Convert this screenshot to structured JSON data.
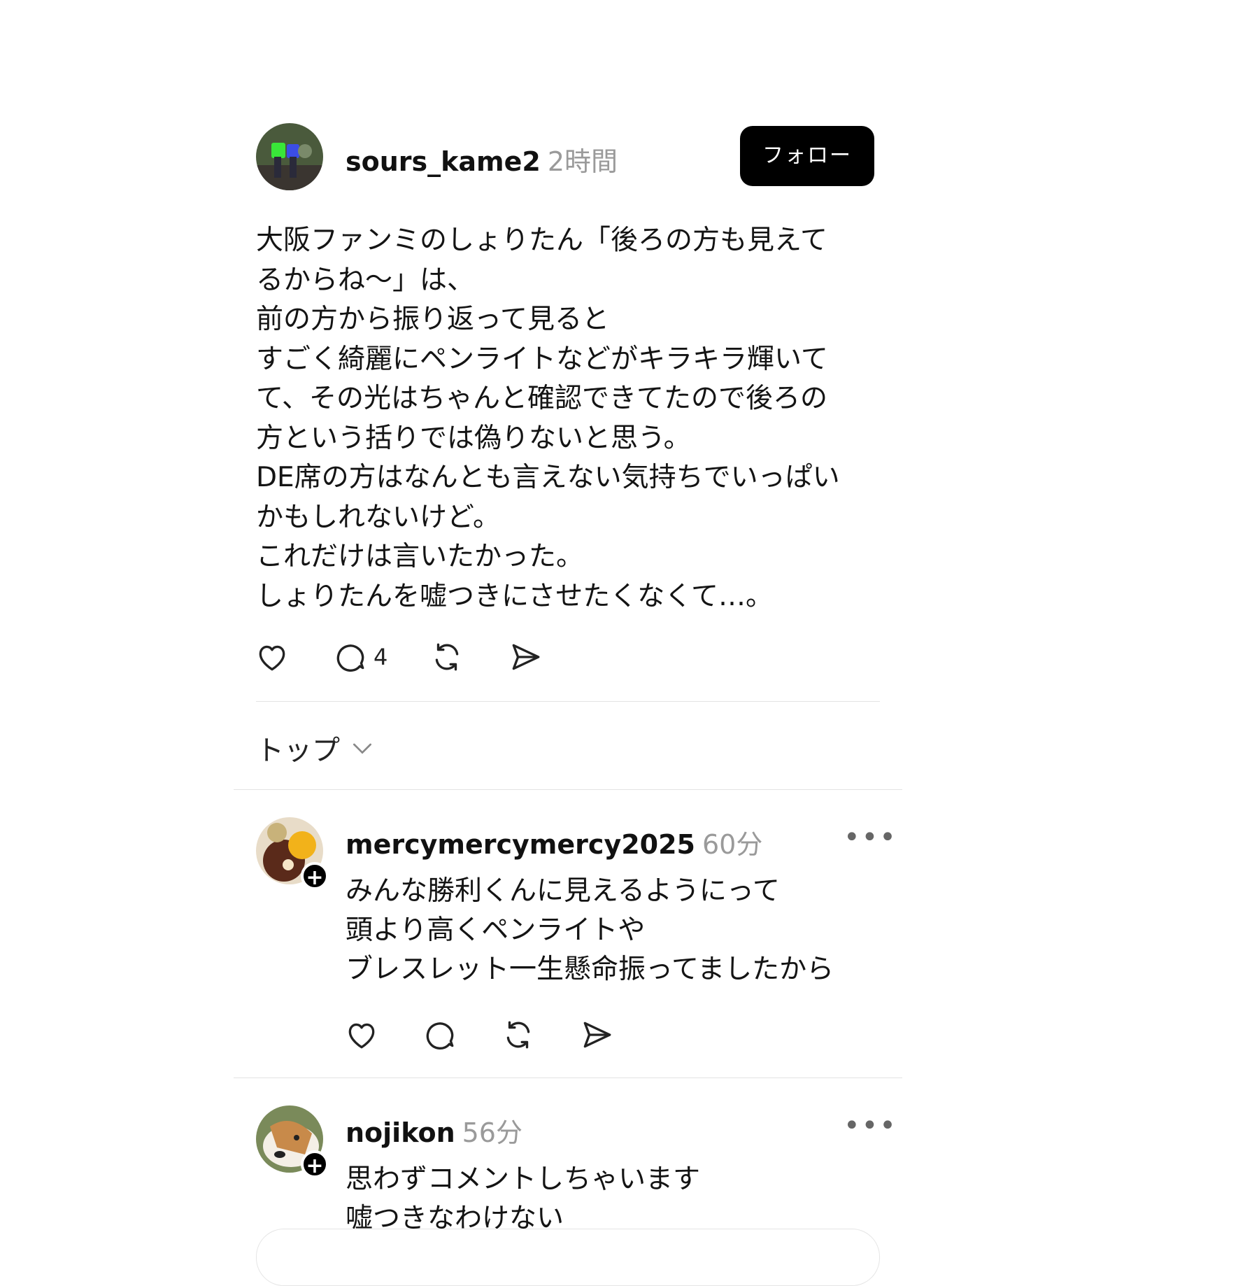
{
  "post": {
    "username": "sours_kame2",
    "time": "2時間",
    "follow_label": "フォロー",
    "body_lines": [
      "大阪ファンミのしょりたん「後ろの方も見えて",
      "るからね〜」は、",
      "前の方から振り返って見ると",
      "すごく綺麗にペンライトなどがキラキラ輝いて",
      "て、その光はちゃんと確認できてたので後ろの",
      "方という括りでは偽りないと思う。",
      "DE席の方はなんとも言えない気持ちでいっぱい",
      "かもしれないけど。",
      "これだけは言いたかった。",
      "しょりたんを嘘つきにさせたくなくて…。"
    ],
    "reply_count": "4"
  },
  "sort": {
    "label": "トップ"
  },
  "replies": [
    {
      "username": "mercymercymercy2025",
      "time": "60分",
      "lines": [
        "みんな勝利くんに見えるようにって",
        "頭より高くペンライトや",
        "ブレスレット一生懸命振ってましたから"
      ]
    },
    {
      "username": "nojikon",
      "time": "56分",
      "lines": [
        "思わずコメントしちゃいます",
        "嘘つきなわけない"
      ]
    }
  ],
  "icons": {
    "like": "heart-icon",
    "comment": "comment-icon",
    "repost": "repost-icon",
    "share": "share-icon",
    "more": "more-icon",
    "sort_chevron": "chevron-down-icon",
    "follow_badge": "plus-icon"
  },
  "more_glyph": "•••",
  "plus_glyph": "+",
  "colors": {
    "follow_bg": "#000000",
    "muted": "#9a9a9a"
  }
}
